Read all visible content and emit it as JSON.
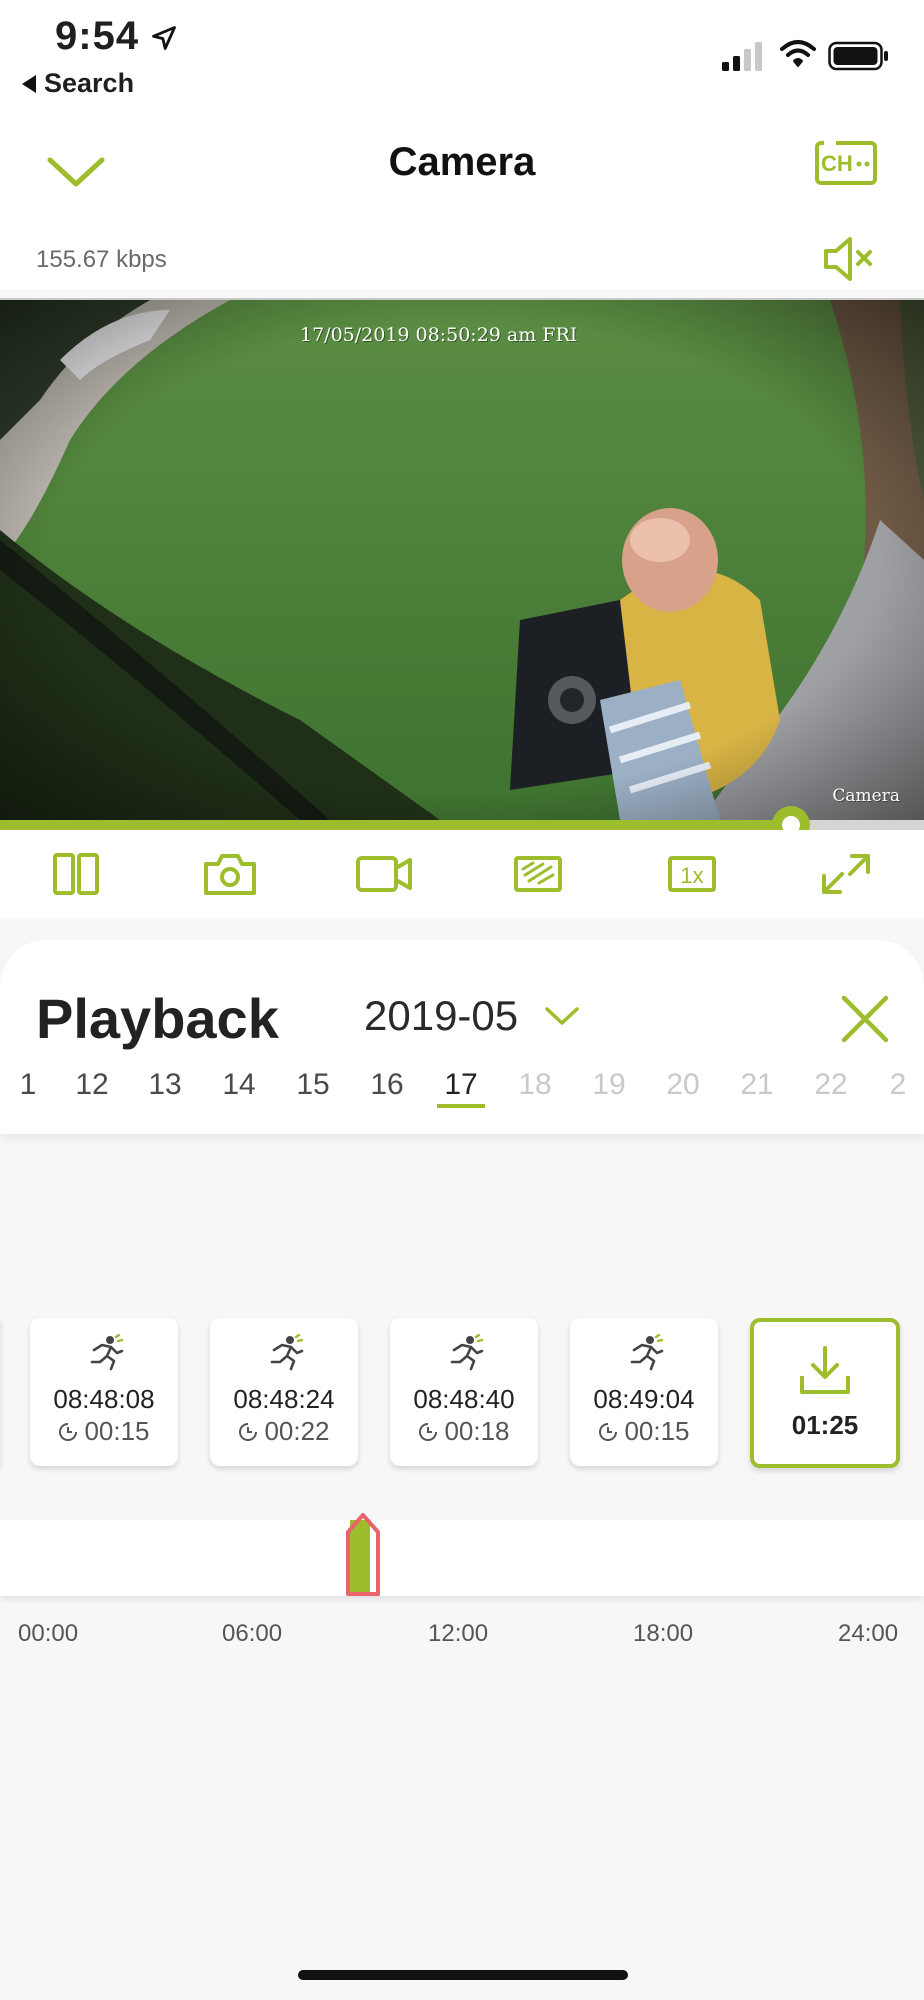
{
  "status_bar": {
    "time": "9:54",
    "back_label": "Search"
  },
  "header": {
    "title": "Camera",
    "bitrate": "155.67 kbps"
  },
  "video": {
    "timestamp_overlay": "17/05/2019 08:50:29 am FRI",
    "camera_label": "Camera",
    "progress": 0.856
  },
  "toolbar": {
    "items": [
      {
        "name": "split-view-icon"
      },
      {
        "name": "snapshot-camera-icon"
      },
      {
        "name": "record-video-icon"
      },
      {
        "name": "hd-quality-icon"
      },
      {
        "name": "speed-1x-icon",
        "label": "1x"
      },
      {
        "name": "fullscreen-icon"
      }
    ]
  },
  "playback": {
    "title": "Playback",
    "month": "2019-05",
    "days": [
      {
        "label": "1",
        "state": "enabled"
      },
      {
        "label": "12",
        "state": "enabled"
      },
      {
        "label": "13",
        "state": "enabled"
      },
      {
        "label": "14",
        "state": "enabled"
      },
      {
        "label": "15",
        "state": "enabled"
      },
      {
        "label": "16",
        "state": "enabled"
      },
      {
        "label": "17",
        "state": "active"
      },
      {
        "label": "18",
        "state": "disabled"
      },
      {
        "label": "19",
        "state": "disabled"
      },
      {
        "label": "20",
        "state": "disabled"
      },
      {
        "label": "21",
        "state": "disabled"
      },
      {
        "label": "22",
        "state": "disabled"
      },
      {
        "label": "2",
        "state": "disabled"
      }
    ]
  },
  "events": [
    {
      "time": "08:48:08",
      "duration": "00:15",
      "icon": "motion-running-icon"
    },
    {
      "time": "08:48:24",
      "duration": "00:22",
      "icon": "motion-running-icon"
    },
    {
      "time": "08:48:40",
      "duration": "00:18",
      "icon": "motion-running-icon"
    },
    {
      "time": "08:49:04",
      "duration": "00:15",
      "icon": "motion-running-icon"
    }
  ],
  "download": {
    "label": "01:25",
    "icon": "download-icon"
  },
  "timeline": {
    "labels": [
      "00:00",
      "06:00",
      "12:00",
      "18:00",
      "24:00"
    ],
    "recording_start_hours": 8.75,
    "recording_end_hours": 8.85
  },
  "colors": {
    "accent": "#9dbd2d",
    "cursor": "#e8646a",
    "disabled_text": "#c9c9c9"
  }
}
